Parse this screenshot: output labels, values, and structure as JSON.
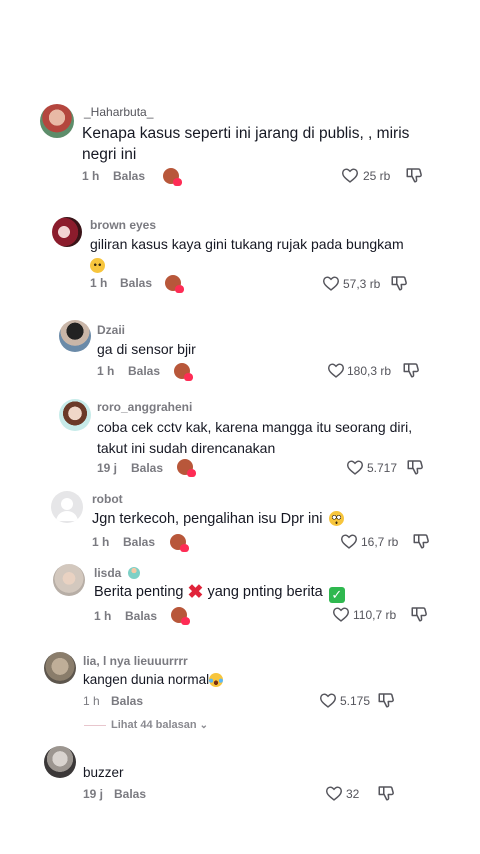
{
  "comments": [
    {
      "username": "_Haharbuta_",
      "text_lines": [
        "Kenapa kasus seperti ini jarang di publis, , miris",
        "negri ini"
      ],
      "time": "1 h",
      "reply": "Balas",
      "likes": "25 rb"
    },
    {
      "username": "brown eyes",
      "text_lines": [
        "giliran kasus kaya gini tukang rujak pada bungkam"
      ],
      "emoji": "pleading-face",
      "time": "1 h",
      "reply": "Balas",
      "likes": "57,3 rb"
    },
    {
      "username": "Dzaii",
      "text_lines": [
        "ga di sensor bjir"
      ],
      "time": "1 h",
      "reply": "Balas",
      "likes": "180,3 rb"
    },
    {
      "username": "roro_anggraheni",
      "text_lines": [
        "coba cek cctv kak, karena mangga itu seorang diri,",
        "takut ini sudah direncanakan"
      ],
      "time": "19 j",
      "reply": "Balas",
      "likes": "5.717"
    },
    {
      "username": "robot",
      "text_lines": [
        "Jgn terkecoh, pengalihan isu Dpr ini"
      ],
      "emoji": "flushed-face",
      "time": "1 h",
      "reply": "Balas",
      "likes": "16,7 rb"
    },
    {
      "username": "lisda",
      "username_emoji": "fairy",
      "text_before": "Berita penting ",
      "text_middle": " yang pnting berita ",
      "time": "1 h",
      "reply": "Balas",
      "likes": "110,7 rb"
    },
    {
      "username": "lia, l nya lieuuurrrr",
      "text_lines": [
        "kangen dunia normal"
      ],
      "emoji": "crying-laughing-face",
      "time": "1 h",
      "reply": "Balas",
      "likes": "5.175"
    },
    {
      "username": "",
      "text_lines": [
        "buzzer"
      ],
      "time": "19 j",
      "reply": "Balas",
      "likes": "32"
    }
  ],
  "view_replies": "Lihat 44 balasan",
  "colors": {
    "like_red": "#fe2c55",
    "muted": "#7a7a80",
    "text": "#161823",
    "check_green": "#2fb84f",
    "cross_red": "#e0243a"
  }
}
